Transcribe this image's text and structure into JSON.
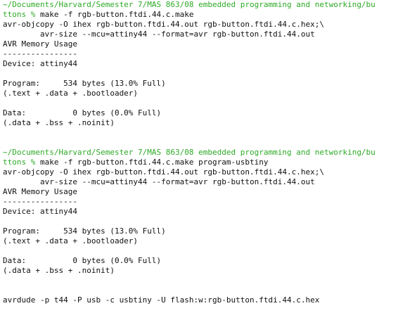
{
  "colors": {
    "background": "#ffffff",
    "text": "#111111",
    "path": "#2eaa27"
  },
  "terminal": {
    "block1": {
      "path_line1": "~/Documents/Harvard/Semester 7/MAS 863/08 embedded programming and networking/bu",
      "path_line2": "ttons",
      "prompt_symbol": "%",
      "command": " make -f rgb-button.ftdi.44.c.make",
      "out1": "avr-objcopy -O ihex rgb-button.ftdi.44.out rgb-button.ftdi.44.c.hex;\\",
      "out2": "        avr-size --mcu=attiny44 --format=avr rgb-button.ftdi.44.out",
      "out3": "AVR Memory Usage",
      "out4": "----------------",
      "out5": "Device: attiny44",
      "out6": "Program:     534 bytes (13.0% Full)",
      "out7": "(.text + .data + .bootloader)",
      "out8": "Data:          0 bytes (0.0% Full)",
      "out9": "(.data + .bss + .noinit)"
    },
    "block2": {
      "path_line1": "~/Documents/Harvard/Semester 7/MAS 863/08 embedded programming and networking/bu",
      "path_line2": "ttons",
      "prompt_symbol": "%",
      "command": " make -f rgb-button.ftdi.44.c.make program-usbtiny",
      "out1": "avr-objcopy -O ihex rgb-button.ftdi.44.out rgb-button.ftdi.44.c.hex;\\",
      "out2": "        avr-size --mcu=attiny44 --format=avr rgb-button.ftdi.44.out",
      "out3": "AVR Memory Usage",
      "out4": "----------------",
      "out5": "Device: attiny44",
      "out6": "Program:     534 bytes (13.0% Full)",
      "out7": "(.text + .data + .bootloader)",
      "out8": "Data:          0 bytes (0.0% Full)",
      "out9": "(.data + .bss + .noinit)",
      "out10": "avrdude -p t44 -P usb -c usbtiny -U flash:w:rgb-button.ftdi.44.c.hex"
    }
  }
}
